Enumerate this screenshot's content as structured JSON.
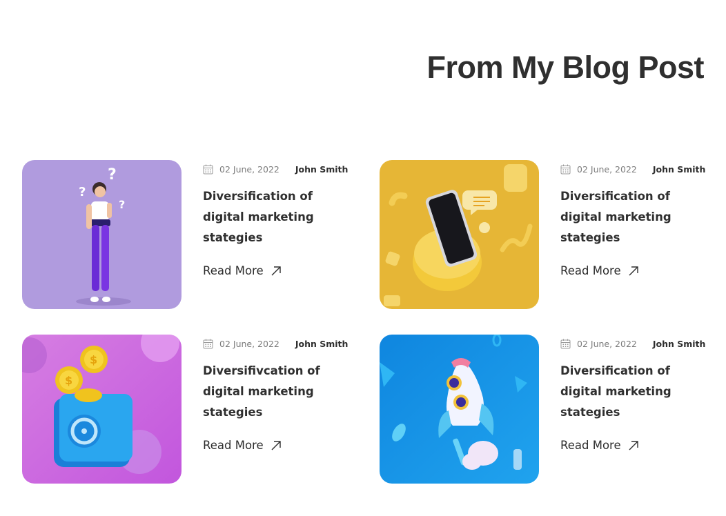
{
  "section": {
    "title": "From My Blog Post"
  },
  "posts": [
    {
      "date": "02 June, 2022",
      "author": "John Smith",
      "title": "Diversification of digital marketing stategies",
      "read_more": "Read More",
      "image_icon": "woman-thinking-illustration",
      "image_bg": "#b19ddd"
    },
    {
      "date": "02 June, 2022",
      "author": "John Smith",
      "title": "Diversification of digital marketing stategies",
      "read_more": "Read More",
      "image_icon": "smartphone-illustration",
      "image_bg": "#e8b938"
    },
    {
      "date": "02 June, 2022",
      "author": "John Smith",
      "title": "Diversifivcation of digital marketing stategies",
      "read_more": "Read More",
      "image_icon": "piggy-safe-coins-illustration",
      "image_bg": "#cf6fe0"
    },
    {
      "date": "02 June, 2022",
      "author": "John Smith",
      "title": "Diversification of digital marketing stategies",
      "read_more": "Read More",
      "image_icon": "rocket-illustration",
      "image_bg": "#1a8fe0"
    }
  ]
}
